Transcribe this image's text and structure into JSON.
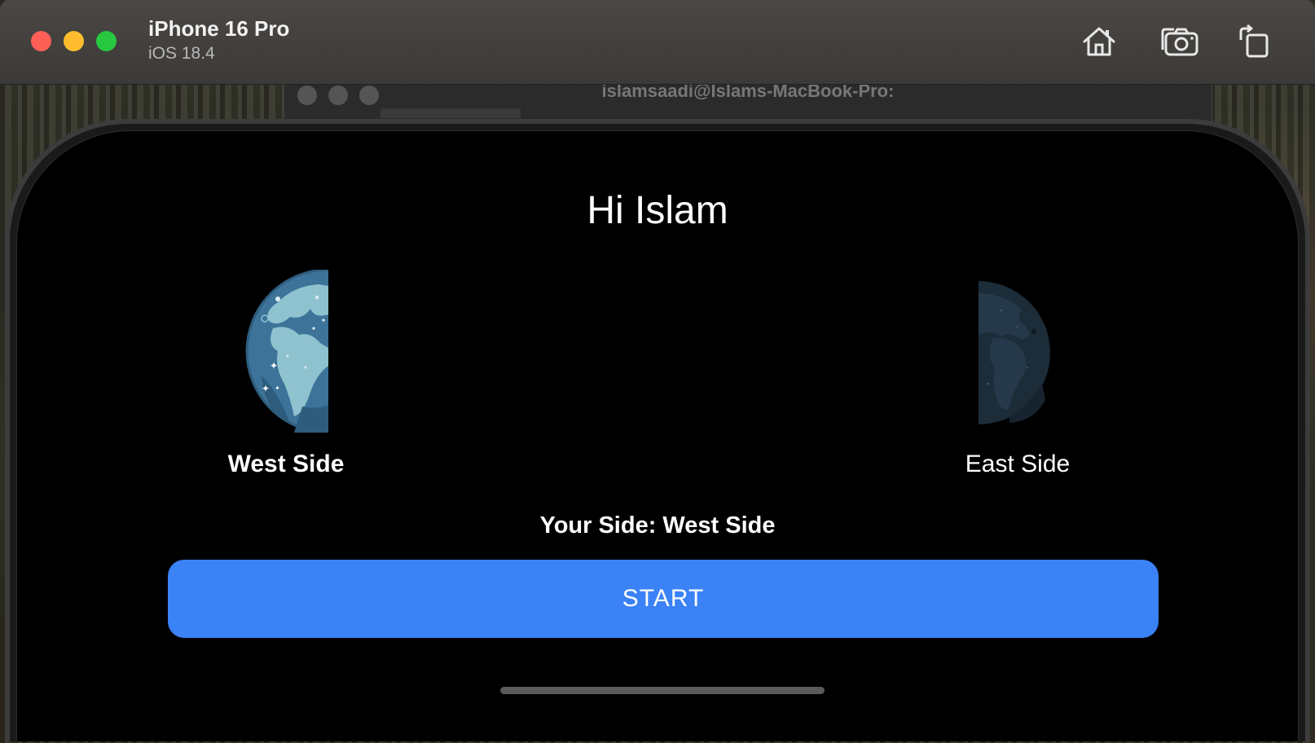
{
  "simulator": {
    "device_name": "iPhone 16 Pro",
    "os_version": "iOS 18.4",
    "icons": [
      "home-icon",
      "screenshot-camera-icon",
      "rotate-icon"
    ]
  },
  "background_window": {
    "title": "islamsaadi@Islams-MacBook-Pro:"
  },
  "app": {
    "greeting": "Hi Islam",
    "west": {
      "label": "West Side",
      "selected": true,
      "icon": "globe-west-half-icon"
    },
    "east": {
      "label": "East Side",
      "selected": false,
      "icon": "globe-east-half-icon"
    },
    "your_side": "Your Side: West Side",
    "start_label": "START"
  },
  "colors": {
    "accent_button": "#3b82f6",
    "screen_background": "#000000",
    "globe_ocean": "#3d7399",
    "globe_land": "#8fc2cf"
  }
}
